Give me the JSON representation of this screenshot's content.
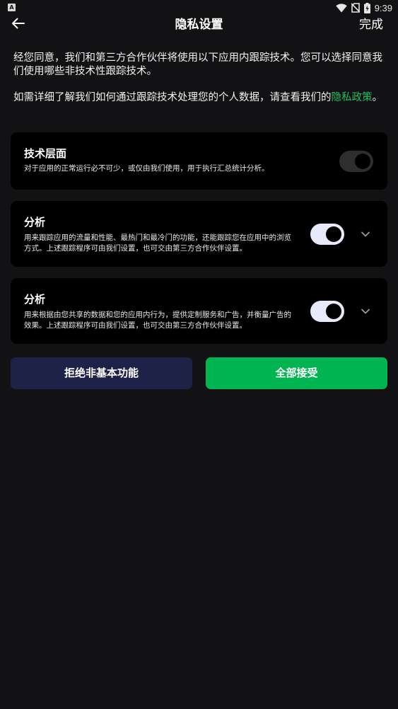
{
  "status_bar": {
    "left_badge": "A",
    "time": "9:39",
    "icons": [
      "wifi-icon",
      "no-sim-icon",
      "battery-charging-icon"
    ]
  },
  "header": {
    "title": "隐私设置",
    "done_label": "完成",
    "back_icon": "arrow-left-icon"
  },
  "intro": {
    "paragraph_1": "经您同意，我们和第三方合作伙伴将使用以下应用内跟踪技术。您可以选择同意我们使用哪些非技术性跟踪技术。",
    "paragraph_2_text": "如需详细了解我们如何通过跟踪技术处理您的个人数据，请查看我们的",
    "paragraph_2_link": "隐私政策",
    "paragraph_2_end": "。"
  },
  "sections": [
    {
      "title": "技术层面",
      "description": "对于应用的正常运行必不可少，或仅由我们使用，用于执行汇总统计分析。",
      "toggle_state": "on-disabled"
    },
    {
      "title": "分析",
      "description": "用来跟踪应用的流量和性能、最热门和最冷门的功能，还能跟踪您在应用中的浏览方式。上述跟踪程序可由我们设置，也可交由第三方合作伙伴设置。",
      "toggle_state": "on",
      "expand_icon": "chevron-down-icon"
    },
    {
      "title": "分析",
      "description": "用来根据由您共享的数据和您的应用内行为，提供定制服务和广告，并衡量广告的效果。上述跟踪程序可由我们设置，也可交由第三方合作伙伴设置。",
      "toggle_state": "on",
      "expand_icon": "chevron-down-icon"
    }
  ],
  "actions": {
    "reject_label": "拒绝非基本功能",
    "accept_label": "全部接受"
  },
  "colors": {
    "background": "#121214",
    "card": "#000000",
    "accent_green": "#00b451",
    "link_green": "#1fc05f",
    "reject_button": "#1e2248",
    "toggle_on": "#e8e9fb"
  }
}
